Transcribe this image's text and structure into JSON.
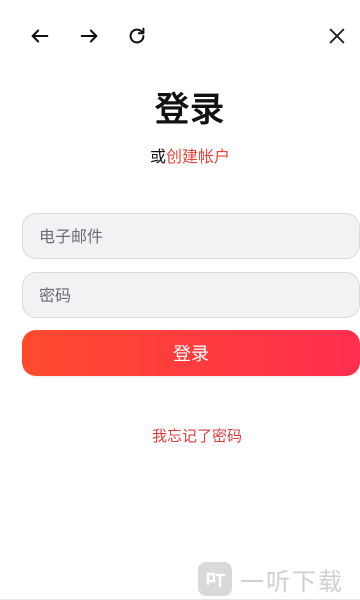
{
  "page": {
    "title": "登录",
    "subtitle_prefix": "或",
    "create_account_link": "创建帐户"
  },
  "form": {
    "email_placeholder": "电子邮件",
    "email_value": "",
    "password_placeholder": "密码",
    "password_value": "",
    "login_button": "登录",
    "forgot_password": "我忘记了密码"
  },
  "nav": {
    "icons": [
      "arrow-left-icon",
      "arrow-right-icon",
      "reload-icon",
      "close-icon"
    ]
  },
  "watermark": {
    "text": "一听下载"
  },
  "colors": {
    "accent_start": "#ff4a2e",
    "accent_end": "#ff2f4f",
    "link": "#e0463c",
    "field_bg": "#f2f2f5"
  }
}
